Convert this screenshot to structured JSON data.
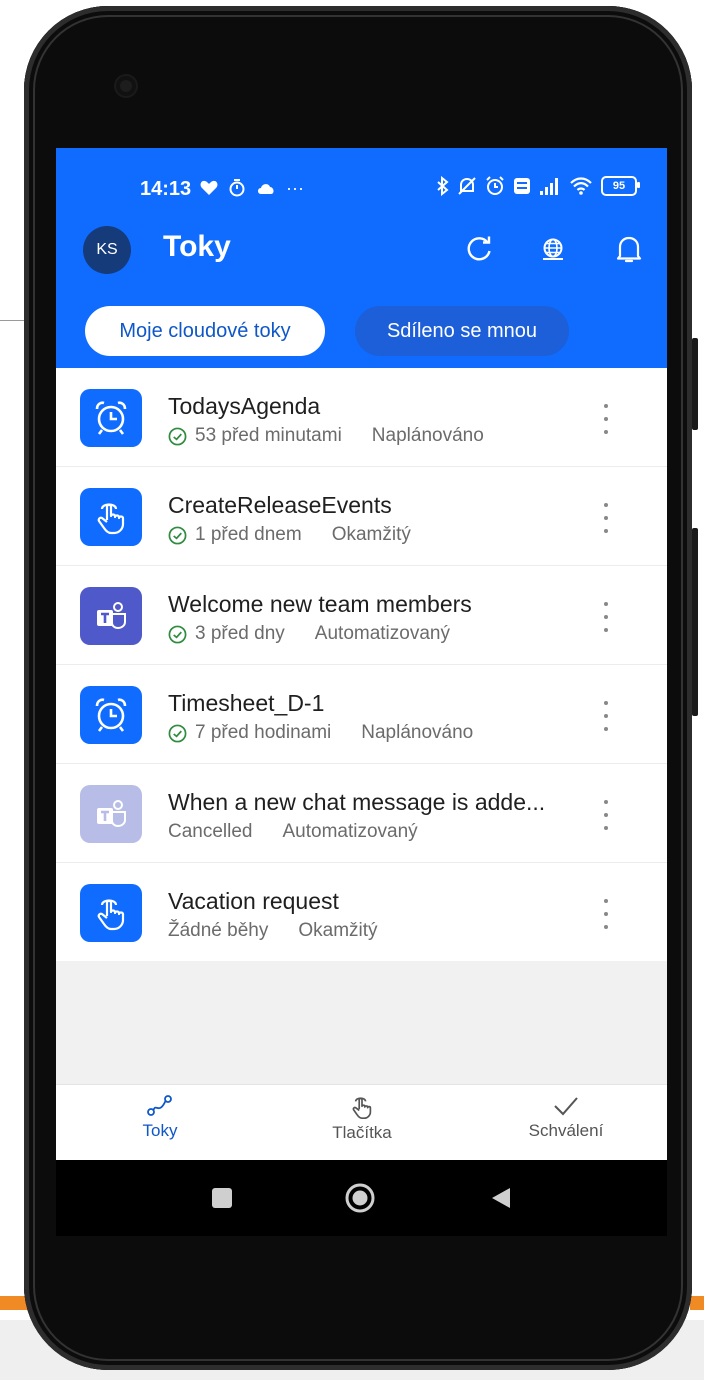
{
  "status_bar": {
    "time": "14:13",
    "battery": "95",
    "left_icons": [
      "heart-icon",
      "timer-icon",
      "cloud-icon",
      "more-dots-icon"
    ],
    "right_icons": [
      "bluetooth-icon",
      "mute-bell-icon",
      "alarm-icon",
      "volte-icon",
      "signal-icon",
      "wifi-icon",
      "battery-icon"
    ]
  },
  "header": {
    "avatar_initials": "KS",
    "title": "Toky",
    "icons": [
      "refresh-icon",
      "globe-icon",
      "bell-icon"
    ]
  },
  "tabs": [
    {
      "label": "Moje cloudové toky",
      "active": true
    },
    {
      "label": "Sdíleno se mnou",
      "active": false
    }
  ],
  "flows": [
    {
      "name": "TodaysAgenda",
      "status": "53 před minutami",
      "type": "Naplánováno",
      "icon": "alarm-clock-icon",
      "color": "#0f6cff",
      "ok": true
    },
    {
      "name": "CreateReleaseEvents",
      "status": "1 před dnem",
      "type": "Okamžitý",
      "icon": "tap-hand-icon",
      "color": "#0f6cff",
      "ok": true
    },
    {
      "name": "Welcome new team members",
      "status": "3 před dny",
      "type": "Automatizovaný",
      "icon": "teams-icon",
      "color": "#5059c9",
      "ok": true
    },
    {
      "name": "Timesheet_D-1",
      "status": "7 před hodinami",
      "type": "Naplánováno",
      "icon": "alarm-clock-icon",
      "color": "#0f6cff",
      "ok": true
    },
    {
      "name": "When a new chat message is adde...",
      "status": "Cancelled",
      "type": "Automatizovaný",
      "icon": "teams-icon",
      "color": "#b8bde8",
      "ok": false
    },
    {
      "name": "Vacation request",
      "status": "Žádné běhy",
      "type": "Okamžitý",
      "icon": "tap-hand-icon",
      "color": "#0f6cff",
      "ok": false
    }
  ],
  "bottom_nav": [
    {
      "label": "Toky",
      "icon": "flow-icon",
      "active": true
    },
    {
      "label": "Tlačítka",
      "icon": "tap-hand-icon",
      "active": false
    },
    {
      "label": "Schválení",
      "icon": "checkmark-icon",
      "active": false
    }
  ],
  "colors": {
    "brand": "#0f6cff",
    "active_nav": "#0f57c9",
    "ok_green": "#2e8b3f"
  }
}
